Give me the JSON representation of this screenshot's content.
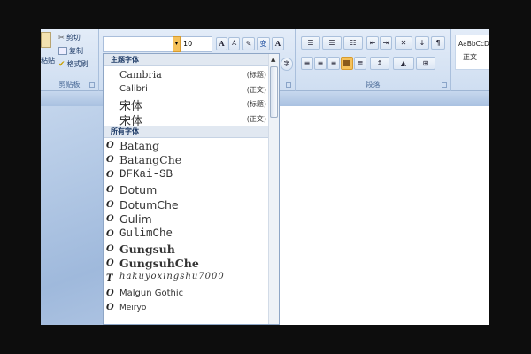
{
  "clipboard": {
    "paste": "粘贴",
    "cut": "剪切",
    "copy": "复制",
    "format_painter": "格式刷",
    "group_label": "剪贴板"
  },
  "font": {
    "name_value": "",
    "size_value": "10",
    "grow": "A",
    "shrink": "A",
    "pinyin": "变",
    "border_char": "A",
    "enclose": "字"
  },
  "paragraph": {
    "group_label": "段落"
  },
  "styles": {
    "preview": "AaBbCcD",
    "name": "正文"
  },
  "dropdown": {
    "theme_header": "主题字体",
    "theme_fonts": [
      {
        "name": "Cambria",
        "tag": "(标题)"
      },
      {
        "name": "Calibri",
        "tag": "(正文)"
      },
      {
        "name": "宋体",
        "tag": "(标题)"
      },
      {
        "name": "宋体",
        "tag": "(正文)"
      }
    ],
    "all_header": "所有字体",
    "all_fonts": [
      {
        "name": "Batang",
        "icon": "O"
      },
      {
        "name": "BatangChe",
        "icon": "O"
      },
      {
        "name": "DFKai-SB",
        "icon": "O"
      },
      {
        "name": "Dotum",
        "icon": "O"
      },
      {
        "name": "DotumChe",
        "icon": "O"
      },
      {
        "name": "Gulim",
        "icon": "O"
      },
      {
        "name": "GulimChe",
        "icon": "O"
      },
      {
        "name": "Gungsuh",
        "icon": "O"
      },
      {
        "name": "GungsuhChe",
        "icon": "O"
      },
      {
        "name": "hakuyoxingshu7000",
        "icon": "T"
      },
      {
        "name": "Malgun Gothic",
        "icon": "O"
      },
      {
        "name": "Meiryo",
        "icon": "O"
      }
    ]
  },
  "colors": {
    "accent": "#f5c15a"
  }
}
